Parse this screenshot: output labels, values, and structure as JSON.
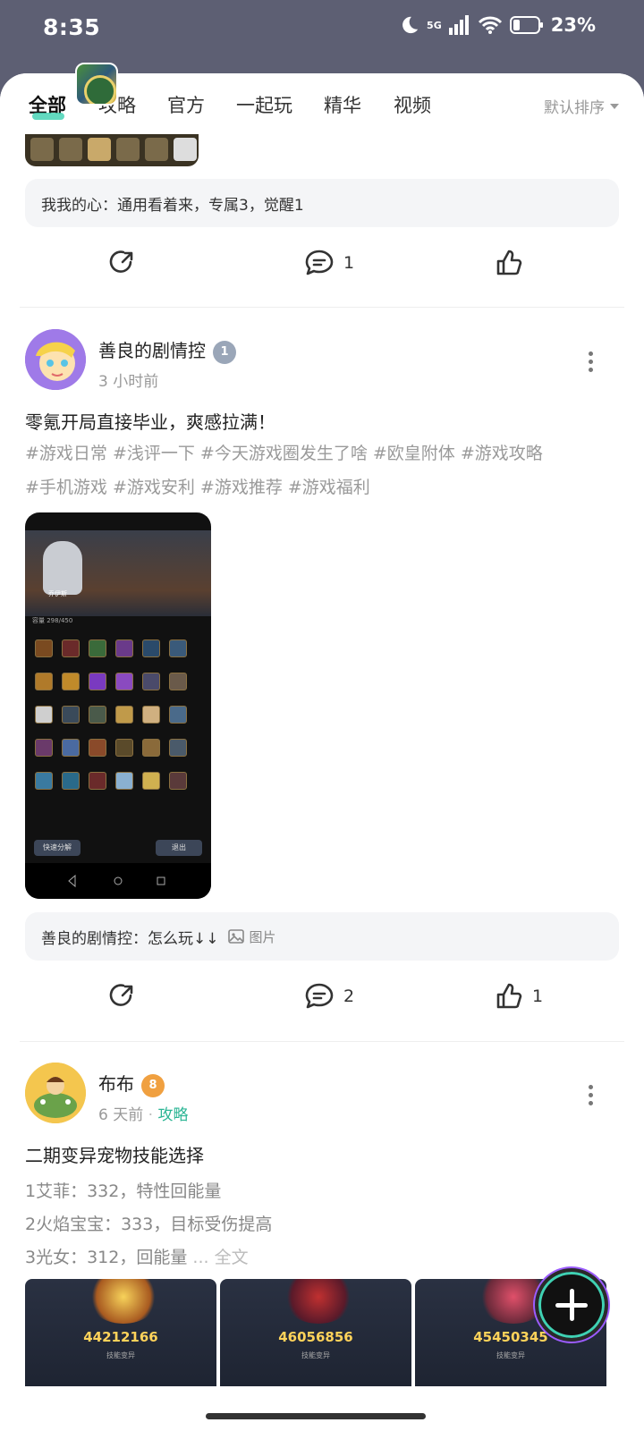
{
  "status_bar": {
    "time": "8:35",
    "network": "5G",
    "battery": "23%"
  },
  "tabs": {
    "items": [
      "全部",
      "攻略",
      "官方",
      "一起玩",
      "精华",
      "视频"
    ],
    "sort_label": "默认排序"
  },
  "post0": {
    "reply_preview": "我我的心：通用看着来，专属3，觉醒1",
    "comment_count": "1"
  },
  "post1": {
    "username": "善良的剧情控",
    "level": "1",
    "time": "3 小时前",
    "title": "零氪开局直接毕业，爽感拉满！",
    "tags_line1": "#游戏日常 #浅评一下 #今天游戏圈发生了啥 #欧皇附体 #游戏攻略",
    "tags_line2": "#手机游戏 #游戏安利 #游戏推荐 #游戏福利",
    "image": {
      "character_name": "乔伊斯",
      "capacity": "容量 298/450",
      "button_left": "快速分解",
      "button_right": "退出"
    },
    "reply_preview": "善良的剧情控：怎么玩↓↓",
    "reply_image_tag": "图片",
    "comment_count": "2",
    "like_count": "1"
  },
  "post2": {
    "username": "布布",
    "level": "8",
    "time": "6 天前",
    "category": "攻略",
    "title": "二期变异宠物技能选择",
    "lines": [
      "1艾菲：332，特性回能量",
      "2火焰宝宝：333，目标受伤提高",
      "3光女：312，回能量"
    ],
    "ellipsis": "...",
    "full_text": "全文",
    "images": [
      {
        "score": "44212166",
        "sub": "技能变异"
      },
      {
        "score": "46056856",
        "sub": "技能变异"
      },
      {
        "score": "45450345",
        "sub": "技能变异"
      }
    ]
  },
  "colors": {
    "accent": "#3ccfb0",
    "category": "#2bb594"
  }
}
